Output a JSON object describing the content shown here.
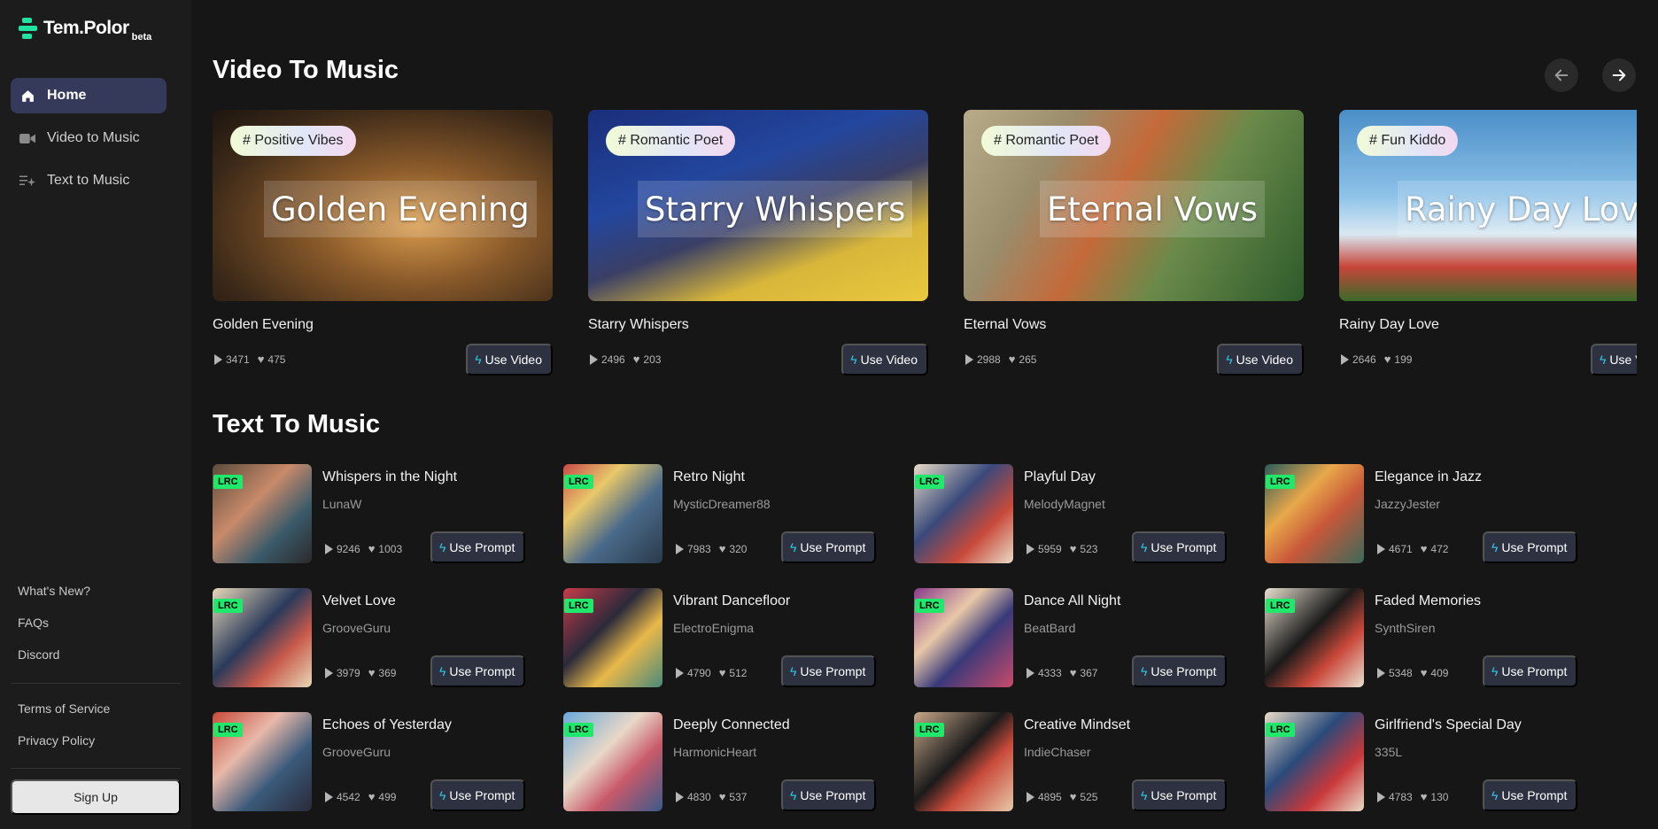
{
  "sidebar": {
    "logo_text": "Tem.Polor",
    "logo_beta": "beta",
    "nav": [
      {
        "label": "Home",
        "icon": "home-icon"
      },
      {
        "label": "Video to Music",
        "icon": "video-camera-icon"
      },
      {
        "label": "Text to Music",
        "icon": "text-sparkle-icon"
      }
    ],
    "links": [
      "What's New?",
      "FAQs",
      "Discord"
    ],
    "legal": [
      "Terms of Service",
      "Privacy Policy"
    ],
    "signup_label": "Sign Up"
  },
  "video_section": {
    "title": "Video To Music",
    "button_label": "Use Video",
    "cards": [
      {
        "tag": "# Positive Vibes",
        "title": "Golden Evening",
        "plays": "3471",
        "likes": "475"
      },
      {
        "tag": "# Romantic Poet",
        "title": "Starry Whispers",
        "plays": "2496",
        "likes": "203"
      },
      {
        "tag": "# Romantic Poet",
        "title": "Eternal Vows",
        "plays": "2988",
        "likes": "265"
      },
      {
        "tag": "# Fun Kiddo",
        "title": "Rainy Day Love",
        "plays": "2646",
        "likes": "199"
      }
    ]
  },
  "text_section": {
    "title": "Text To Music",
    "badge": "LRC",
    "button_label": "Use Prompt",
    "cards": [
      {
        "title": "Whispers in the Night",
        "author": "LunaW",
        "plays": "9246",
        "likes": "1003"
      },
      {
        "title": "Retro Night",
        "author": "MysticDreamer88",
        "plays": "7983",
        "likes": "320"
      },
      {
        "title": "Playful Day",
        "author": "MelodyMagnet",
        "plays": "5959",
        "likes": "523"
      },
      {
        "title": "Elegance in Jazz",
        "author": "JazzyJester",
        "plays": "4671",
        "likes": "472"
      },
      {
        "title": "Velvet Love",
        "author": "GrooveGuru",
        "plays": "3979",
        "likes": "369"
      },
      {
        "title": "Vibrant Dancefloor",
        "author": "ElectroEnigma",
        "plays": "4790",
        "likes": "512"
      },
      {
        "title": "Dance All Night",
        "author": "BeatBard",
        "plays": "4333",
        "likes": "367"
      },
      {
        "title": "Faded Memories",
        "author": "SynthSiren",
        "plays": "5348",
        "likes": "409"
      },
      {
        "title": "Echoes of Yesterday",
        "author": "GrooveGuru",
        "plays": "4542",
        "likes": "499"
      },
      {
        "title": "Deeply Connected",
        "author": "HarmonicHeart",
        "plays": "4830",
        "likes": "537"
      },
      {
        "title": "Creative Mindset",
        "author": "IndieChaser",
        "plays": "4895",
        "likes": "525"
      },
      {
        "title": "Girlfriend's Special Day",
        "author": "335L",
        "plays": "4783",
        "likes": "130"
      }
    ]
  },
  "colors": {
    "accent": "#1fe3a0",
    "lrc_badge": "#1fe86a",
    "active_nav": "#363a5a",
    "button_bg": "#2e3140"
  }
}
